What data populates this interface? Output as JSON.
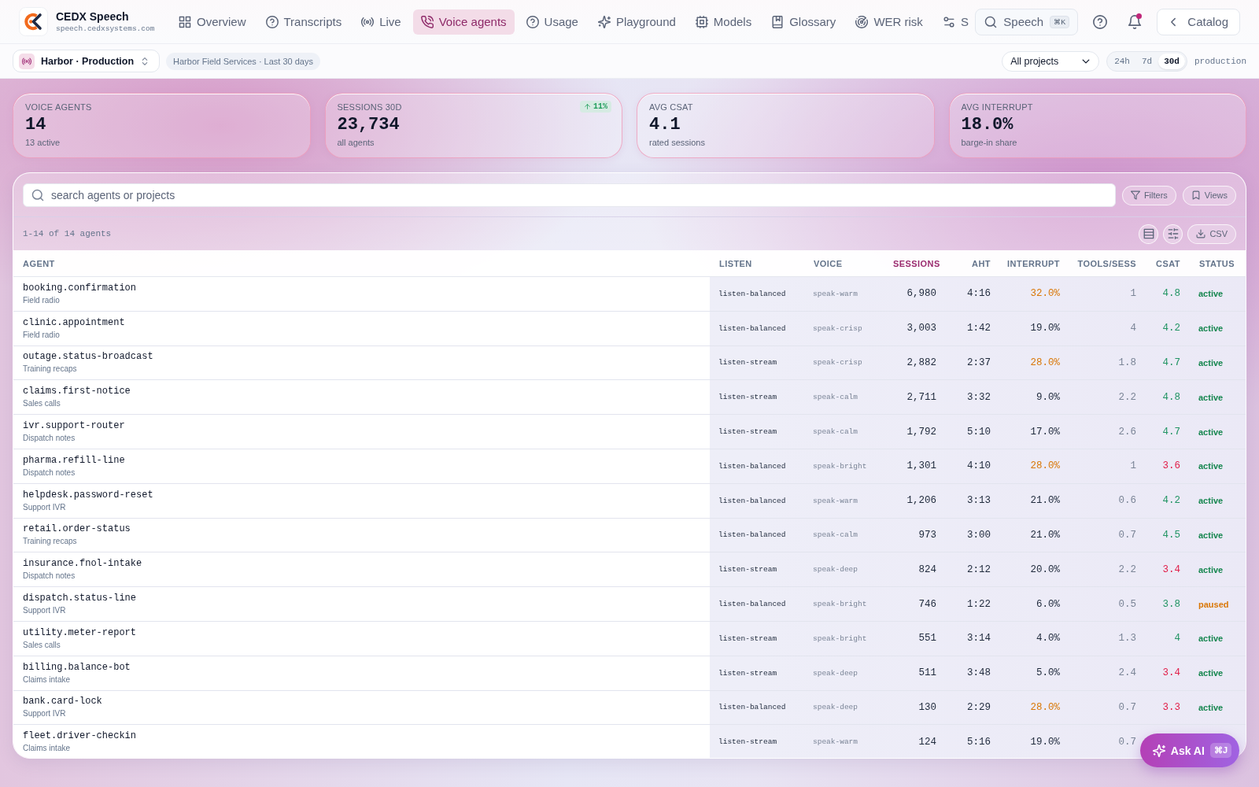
{
  "app": {
    "brand": "CEDX Speech",
    "domain": "speech.cedxsystems.com"
  },
  "nav": {
    "items": [
      {
        "label": "Overview",
        "selected": false
      },
      {
        "label": "Transcripts",
        "selected": false
      },
      {
        "label": "Live",
        "selected": false
      },
      {
        "label": "Voice agents",
        "selected": true
      },
      {
        "label": "Usage",
        "selected": false
      },
      {
        "label": "Playground",
        "selected": false
      },
      {
        "label": "Models",
        "selected": false
      },
      {
        "label": "Glossary",
        "selected": false
      },
      {
        "label": "WER risk",
        "selected": false
      },
      {
        "label": "S",
        "selected": false
      }
    ],
    "search": {
      "label": "Speech",
      "shortcut": "⌘K"
    },
    "notifications": {
      "unread": true
    },
    "catalog": "Catalog"
  },
  "context_bar": {
    "project": "Harbor · Production",
    "scope": "Harbor Field Services · Last 30 days",
    "project_filter": "All projects",
    "ranges": [
      {
        "label": "24h",
        "selected": false
      },
      {
        "label": "7d",
        "selected": false
      },
      {
        "label": "30d",
        "selected": true
      }
    ],
    "environment": "production"
  },
  "kpis": [
    {
      "label": "VOICE AGENTS",
      "value": "14",
      "sub": "13 active"
    },
    {
      "label": "SESSIONS 30D",
      "value": "23,734",
      "sub": "all agents",
      "trend": "11%"
    },
    {
      "label": "AVG CSAT",
      "value": "4.1",
      "sub": "rated sessions"
    },
    {
      "label": "AVG INTERRUPT",
      "value": "18.0%",
      "sub": "barge-in share"
    }
  ],
  "toolbar": {
    "search_placeholder": "search agents or projects",
    "buttons": [
      "Filters",
      "Views"
    ]
  },
  "table": {
    "count": "1-14 of 14 agents",
    "export": "CSV",
    "columns": [
      {
        "label": "AGENT",
        "sorted": false
      },
      {
        "label": "LISTEN",
        "sorted": false
      },
      {
        "label": "VOICE",
        "sorted": false
      },
      {
        "label": "SESSIONS",
        "sorted": true
      },
      {
        "label": "AHT",
        "sorted": false
      },
      {
        "label": "INTERRUPT",
        "sorted": false
      },
      {
        "label": "TOOLS/SESS",
        "sorted": false
      },
      {
        "label": "CSAT",
        "sorted": false
      },
      {
        "label": "STATUS",
        "sorted": false
      }
    ],
    "rows": [
      {
        "agent": "booking.confirmation",
        "team": "Field radio",
        "listen": "listen-balanced",
        "voice": "speak-warm",
        "sessions": "6,980",
        "aht": "4:16",
        "interrupt": "32.0%",
        "interrupt_high": true,
        "tools": "1",
        "csat": "4.8",
        "csat_low": false,
        "status": "active",
        "status_paused": false
      },
      {
        "agent": "clinic.appointment",
        "team": "Field radio",
        "listen": "listen-balanced",
        "voice": "speak-crisp",
        "sessions": "3,003",
        "aht": "1:42",
        "interrupt": "19.0%",
        "interrupt_high": false,
        "tools": "4",
        "csat": "4.2",
        "csat_low": false,
        "status": "active",
        "status_paused": false
      },
      {
        "agent": "outage.status-broadcast",
        "team": "Training recaps",
        "listen": "listen-stream",
        "voice": "speak-crisp",
        "sessions": "2,882",
        "aht": "2:37",
        "interrupt": "28.0%",
        "interrupt_high": true,
        "tools": "1.8",
        "csat": "4.7",
        "csat_low": false,
        "status": "active",
        "status_paused": false
      },
      {
        "agent": "claims.first-notice",
        "team": "Sales calls",
        "listen": "listen-stream",
        "voice": "speak-calm",
        "sessions": "2,711",
        "aht": "3:32",
        "interrupt": "9.0%",
        "interrupt_high": false,
        "tools": "2.2",
        "csat": "4.8",
        "csat_low": false,
        "status": "active",
        "status_paused": false
      },
      {
        "agent": "ivr.support-router",
        "team": "Dispatch notes",
        "listen": "listen-stream",
        "voice": "speak-calm",
        "sessions": "1,792",
        "aht": "5:10",
        "interrupt": "17.0%",
        "interrupt_high": false,
        "tools": "2.6",
        "csat": "4.7",
        "csat_low": false,
        "status": "active",
        "status_paused": false
      },
      {
        "agent": "pharma.refill-line",
        "team": "Dispatch notes",
        "listen": "listen-balanced",
        "voice": "speak-bright",
        "sessions": "1,301",
        "aht": "4:10",
        "interrupt": "28.0%",
        "interrupt_high": true,
        "tools": "1",
        "csat": "3.6",
        "csat_low": true,
        "status": "active",
        "status_paused": false
      },
      {
        "agent": "helpdesk.password-reset",
        "team": "Support IVR",
        "listen": "listen-balanced",
        "voice": "speak-warm",
        "sessions": "1,206",
        "aht": "3:13",
        "interrupt": "21.0%",
        "interrupt_high": false,
        "tools": "0.6",
        "csat": "4.2",
        "csat_low": false,
        "status": "active",
        "status_paused": false
      },
      {
        "agent": "retail.order-status",
        "team": "Training recaps",
        "listen": "listen-balanced",
        "voice": "speak-calm",
        "sessions": "973",
        "aht": "3:00",
        "interrupt": "21.0%",
        "interrupt_high": false,
        "tools": "0.7",
        "csat": "4.5",
        "csat_low": false,
        "status": "active",
        "status_paused": false
      },
      {
        "agent": "insurance.fnol-intake",
        "team": "Dispatch notes",
        "listen": "listen-stream",
        "voice": "speak-deep",
        "sessions": "824",
        "aht": "2:12",
        "interrupt": "20.0%",
        "interrupt_high": false,
        "tools": "2.2",
        "csat": "3.4",
        "csat_low": true,
        "status": "active",
        "status_paused": false
      },
      {
        "agent": "dispatch.status-line",
        "team": "Support IVR",
        "listen": "listen-balanced",
        "voice": "speak-bright",
        "sessions": "746",
        "aht": "1:22",
        "interrupt": "6.0%",
        "interrupt_high": false,
        "tools": "0.5",
        "csat": "3.8",
        "csat_low": false,
        "status": "paused",
        "status_paused": true
      },
      {
        "agent": "utility.meter-report",
        "team": "Sales calls",
        "listen": "listen-stream",
        "voice": "speak-bright",
        "sessions": "551",
        "aht": "3:14",
        "interrupt": "4.0%",
        "interrupt_high": false,
        "tools": "1.3",
        "csat": "4",
        "csat_low": false,
        "status": "active",
        "status_paused": false
      },
      {
        "agent": "billing.balance-bot",
        "team": "Claims intake",
        "listen": "listen-stream",
        "voice": "speak-deep",
        "sessions": "511",
        "aht": "3:48",
        "interrupt": "5.0%",
        "interrupt_high": false,
        "tools": "2.4",
        "csat": "3.4",
        "csat_low": true,
        "status": "active",
        "status_paused": false
      },
      {
        "agent": "bank.card-lock",
        "team": "Support IVR",
        "listen": "listen-balanced",
        "voice": "speak-deep",
        "sessions": "130",
        "aht": "2:29",
        "interrupt": "28.0%",
        "interrupt_high": true,
        "tools": "0.7",
        "csat": "3.3",
        "csat_low": true,
        "status": "active",
        "status_paused": false
      },
      {
        "agent": "fleet.driver-checkin",
        "team": "Claims intake",
        "listen": "listen-stream",
        "voice": "speak-warm",
        "sessions": "124",
        "aht": "5:16",
        "interrupt": "19.0%",
        "interrupt_high": false,
        "tools": "0.7"
      }
    ]
  },
  "ask_ai": {
    "label": "Ask AI",
    "shortcut": "⌘J"
  }
}
